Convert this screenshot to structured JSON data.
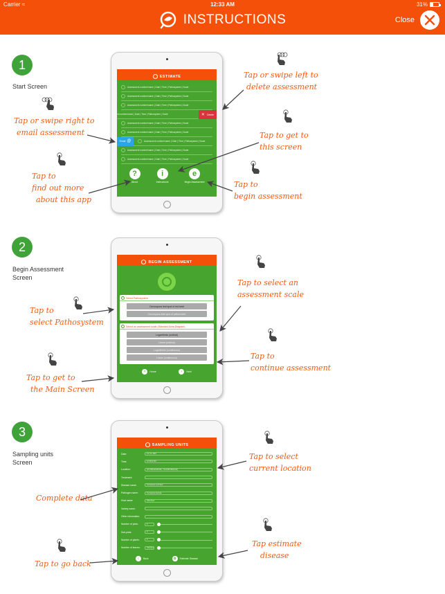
{
  "status_bar": {
    "carrier": "Carrier",
    "wifi_icon": "wifi-icon",
    "time": "12:33 AM",
    "battery": "31%"
  },
  "header": {
    "title": "INSTRUCTIONS",
    "logo_icon": "leaf-magnifier-logo-icon",
    "close_label": "Close",
    "close_icon": "close-x-icon",
    "background": "#f5500a"
  },
  "colors": {
    "accent_orange": "#f5500a",
    "app_green": "#47a42e",
    "badge_green": "#3fa33a",
    "delete_red": "#d9343c",
    "email_blue": "#2aa6e6"
  },
  "steps": [
    {
      "number": "1",
      "label": "Start Screen",
      "screen": {
        "title": "ESTIMATE",
        "rows": [
          "Assessment number/name | Date | Time | Pathosystem | Scale",
          "Assessment number/name | Date | Time | Pathosystem | Scale",
          "Assessment number/name | Date | Time | Pathosystem | Scale",
          "nt number/name | Date | Time | Pathosystem | Scale",
          "Assessment number/name | Date | Time | Pathosystem | Scale",
          "Assessment number/name | Date | Time | Pathosystem | Scale",
          "Assessment number/name | Date | Time | Pathosystem | Scale",
          "Assessment number/name | Date | Time | Pathosystem | Scale",
          "Assessment number/name | Date | Time | Pathosystem | Scale"
        ],
        "delete_label": "Delete",
        "email_label": "Email",
        "bottom_buttons": [
          {
            "label": "About",
            "glyph": "?"
          },
          {
            "label": "Instructions",
            "glyph": "i"
          },
          {
            "label": "Begin Assessment",
            "glyph": "e"
          }
        ]
      },
      "notes": {
        "swipe_left": [
          "Tap or swipe left to",
          "delete assessment"
        ],
        "swipe_right": [
          "Tap or swipe right to",
          "email assessment"
        ],
        "get_here": [
          "Tap to get to",
          "this screen"
        ],
        "about": [
          "Tap to",
          "find out more",
          "about this app"
        ],
        "begin": [
          "Tap to",
          "begin assessment"
        ]
      }
    },
    {
      "number": "2",
      "label": "Begin Assessment Screen",
      "screen": {
        "title": "BEGIN ASSESSMENT",
        "pathosystem_title": "Select Pathosystem",
        "pathosystems": [
          {
            "label": "Cercospora leaf spot of red beet",
            "selected": true
          },
          {
            "label": "Cercospora leaf spot of yellow beet",
            "selected": false
          }
        ],
        "scale_title": "Select an assessment scale (Standard Area Diagram)",
        "scales": [
          {
            "label": "Logarithmic (ordinal)",
            "selected": true
          },
          {
            "label": "Linear (ordinal)",
            "selected": false
          },
          {
            "label": "Logarithmic (continuous)",
            "selected": false
          },
          {
            "label": "Linear (continuous)",
            "selected": false
          }
        ],
        "home_label": "Home",
        "next_label": "Next"
      },
      "notes": {
        "pathosystem": [
          "Tap to",
          "select Pathosystem"
        ],
        "main_screen": [
          "Tap to get to",
          "the Main Screen"
        ],
        "scale": [
          "Tap to select an",
          "assessment scale"
        ],
        "continue": [
          "Tap to",
          "continue assessment"
        ]
      }
    },
    {
      "number": "3",
      "label": "Sampling units Screen",
      "screen": {
        "title": "SAMPLING UNITS",
        "fields": [
          {
            "label": "Date:",
            "value": "Jun 14, 2016"
          },
          {
            "label": "Time:",
            "value": "12:33:02 PM"
          },
          {
            "label": "Location:",
            "value": "(43.7695123456789, -76.2345678901234)"
          },
          {
            "label": "Treatment:",
            "value": ""
          },
          {
            "label": "Disease name:",
            "value": "Cercospora Leaf Spot"
          },
          {
            "label": "Pathogen name:",
            "value": "Cercospora beticola"
          },
          {
            "label": "Host name:",
            "value": "Table Beet"
          },
          {
            "label": "Variety name:",
            "value": ""
          },
          {
            "label": "Other information:",
            "value": ""
          }
        ],
        "counters": [
          {
            "label": "Number of plots:",
            "value": "0"
          },
          {
            "label": "Sub-plots:",
            "value": "0"
          },
          {
            "label": "Number of plants:",
            "value": "0"
          },
          {
            "label": "Number of leaves:",
            "value": "Unlimited"
          }
        ],
        "back_label": "Back",
        "estimate_label": "Estimate Disease"
      },
      "notes": {
        "location": [
          "Tap to select",
          "current location"
        ],
        "complete": [
          "Complete data"
        ],
        "go_back": [
          "Tap to go back"
        ],
        "estimate": [
          "Tap estimate",
          "disease"
        ]
      }
    }
  ]
}
